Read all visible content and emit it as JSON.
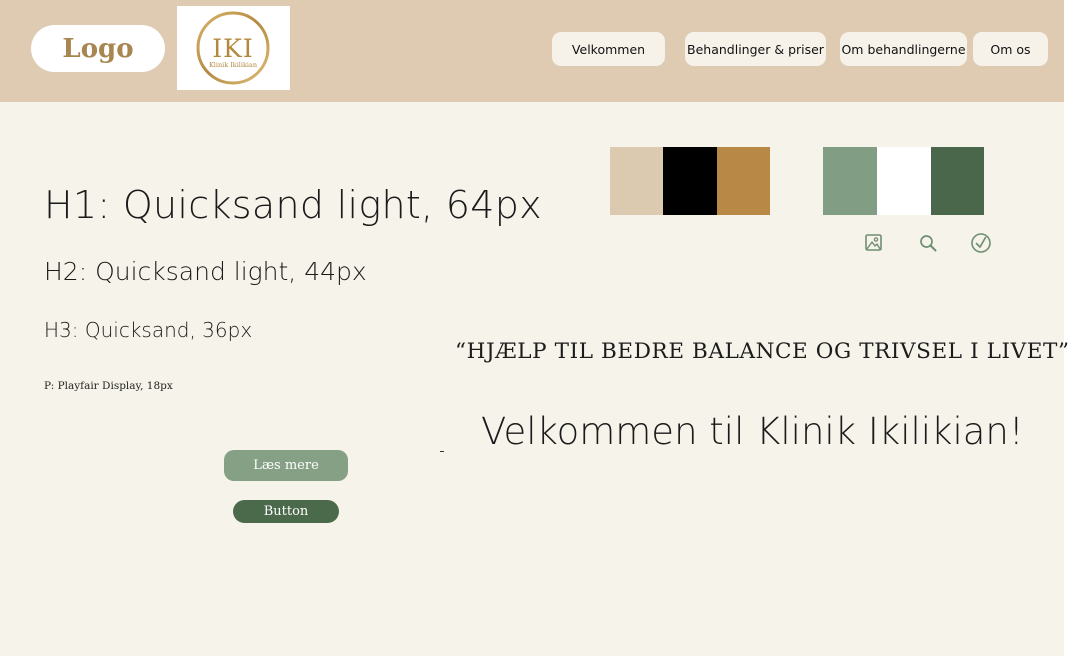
{
  "header": {
    "logo_text": "Logo",
    "emblem": {
      "monogram": "IKI",
      "name": "Klinik Ikilikian"
    },
    "nav": [
      {
        "label": "Velkommen"
      },
      {
        "label": "Behandlinger & priser"
      },
      {
        "label": "Om behandlingerne"
      },
      {
        "label": "Om os"
      }
    ]
  },
  "typography": {
    "h1": "H1: Quicksand light, 64px",
    "h2": "H2: Quicksand light, 44px",
    "h3": "H3: Quicksand, 36px",
    "p": "P: Playfair Display, 18px"
  },
  "palette": {
    "primary": [
      "#dccab0",
      "#000000",
      "#b88846"
    ],
    "secondary": [
      "#819d84",
      "#ffffff",
      "#4a674b"
    ]
  },
  "icons": [
    "image-icon",
    "search-icon",
    "check-circle-icon"
  ],
  "content": {
    "quote": "“HJÆLP TIL BEDRE BALANCE OG TRIVSEL I LIVET”",
    "welcome": "Velkommen til Klinik Ikilikian!"
  },
  "buttons": {
    "read_more": "Læs mere",
    "generic": "Button"
  },
  "colors": {
    "header_bg": "#decbb2",
    "page_bg": "#f6f3ea",
    "gold": "#b3893f",
    "sage": "#85a084",
    "forest": "#4a6a4b"
  }
}
